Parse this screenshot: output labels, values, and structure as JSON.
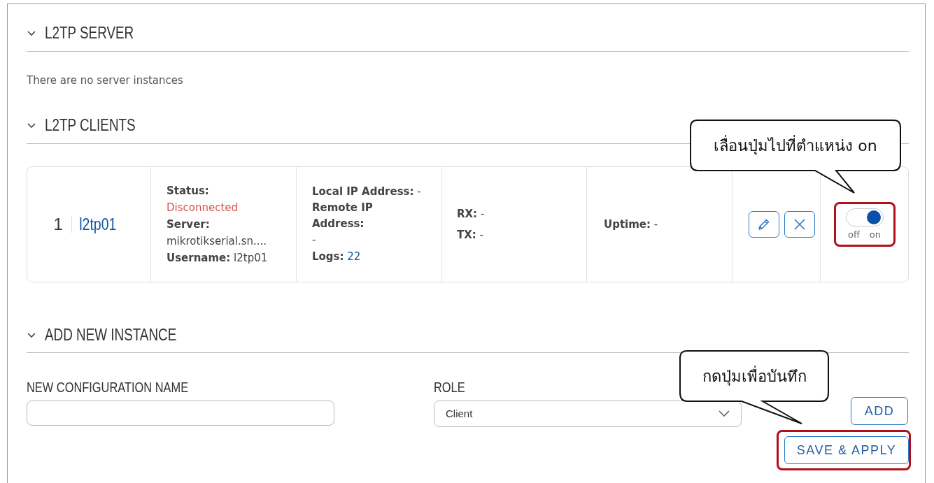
{
  "server_section": {
    "title": "L2TP SERVER",
    "expanded": true,
    "empty_message": "There are no server instances"
  },
  "clients_section": {
    "title": "L2TP CLIENTS",
    "expanded": true,
    "clients": [
      {
        "number": "1",
        "name": "l2tp01",
        "status_label": "Status:",
        "status": "Disconnected",
        "connected": false,
        "server_label": "Server:",
        "server": "mikrotikserial.sn....",
        "username_label": "Username:",
        "username": "l2tp01",
        "local_ip_label": "Local IP Address:",
        "local_ip": "-",
        "remote_ip_label": "Remote IP Address:",
        "remote_ip": "-",
        "logs_label": "Logs:",
        "logs": "22",
        "rx_label": "RX:",
        "rx": "-",
        "tx_label": "TX:",
        "tx": "-",
        "uptime_label": "Uptime:",
        "uptime": "-",
        "enabled": true,
        "off_label": "off",
        "on_label": "on",
        "highlighted": true
      }
    ]
  },
  "add_section": {
    "title": "ADD NEW INSTANCE",
    "expanded": true,
    "name_label": "NEW CONFIGURATION NAME",
    "role_label": "ROLE",
    "role_value": "Client",
    "add_button": "ADD"
  },
  "save_button": {
    "label": "SAVE & APPLY",
    "highlighted": true
  },
  "callouts": [
    {
      "text": "เลื่อนปุ่มไปที่ตำแหน่ง on",
      "kind": "toggle"
    },
    {
      "text": "กดปุ่มเพื่อบันทึก",
      "kind": "save"
    }
  ]
}
